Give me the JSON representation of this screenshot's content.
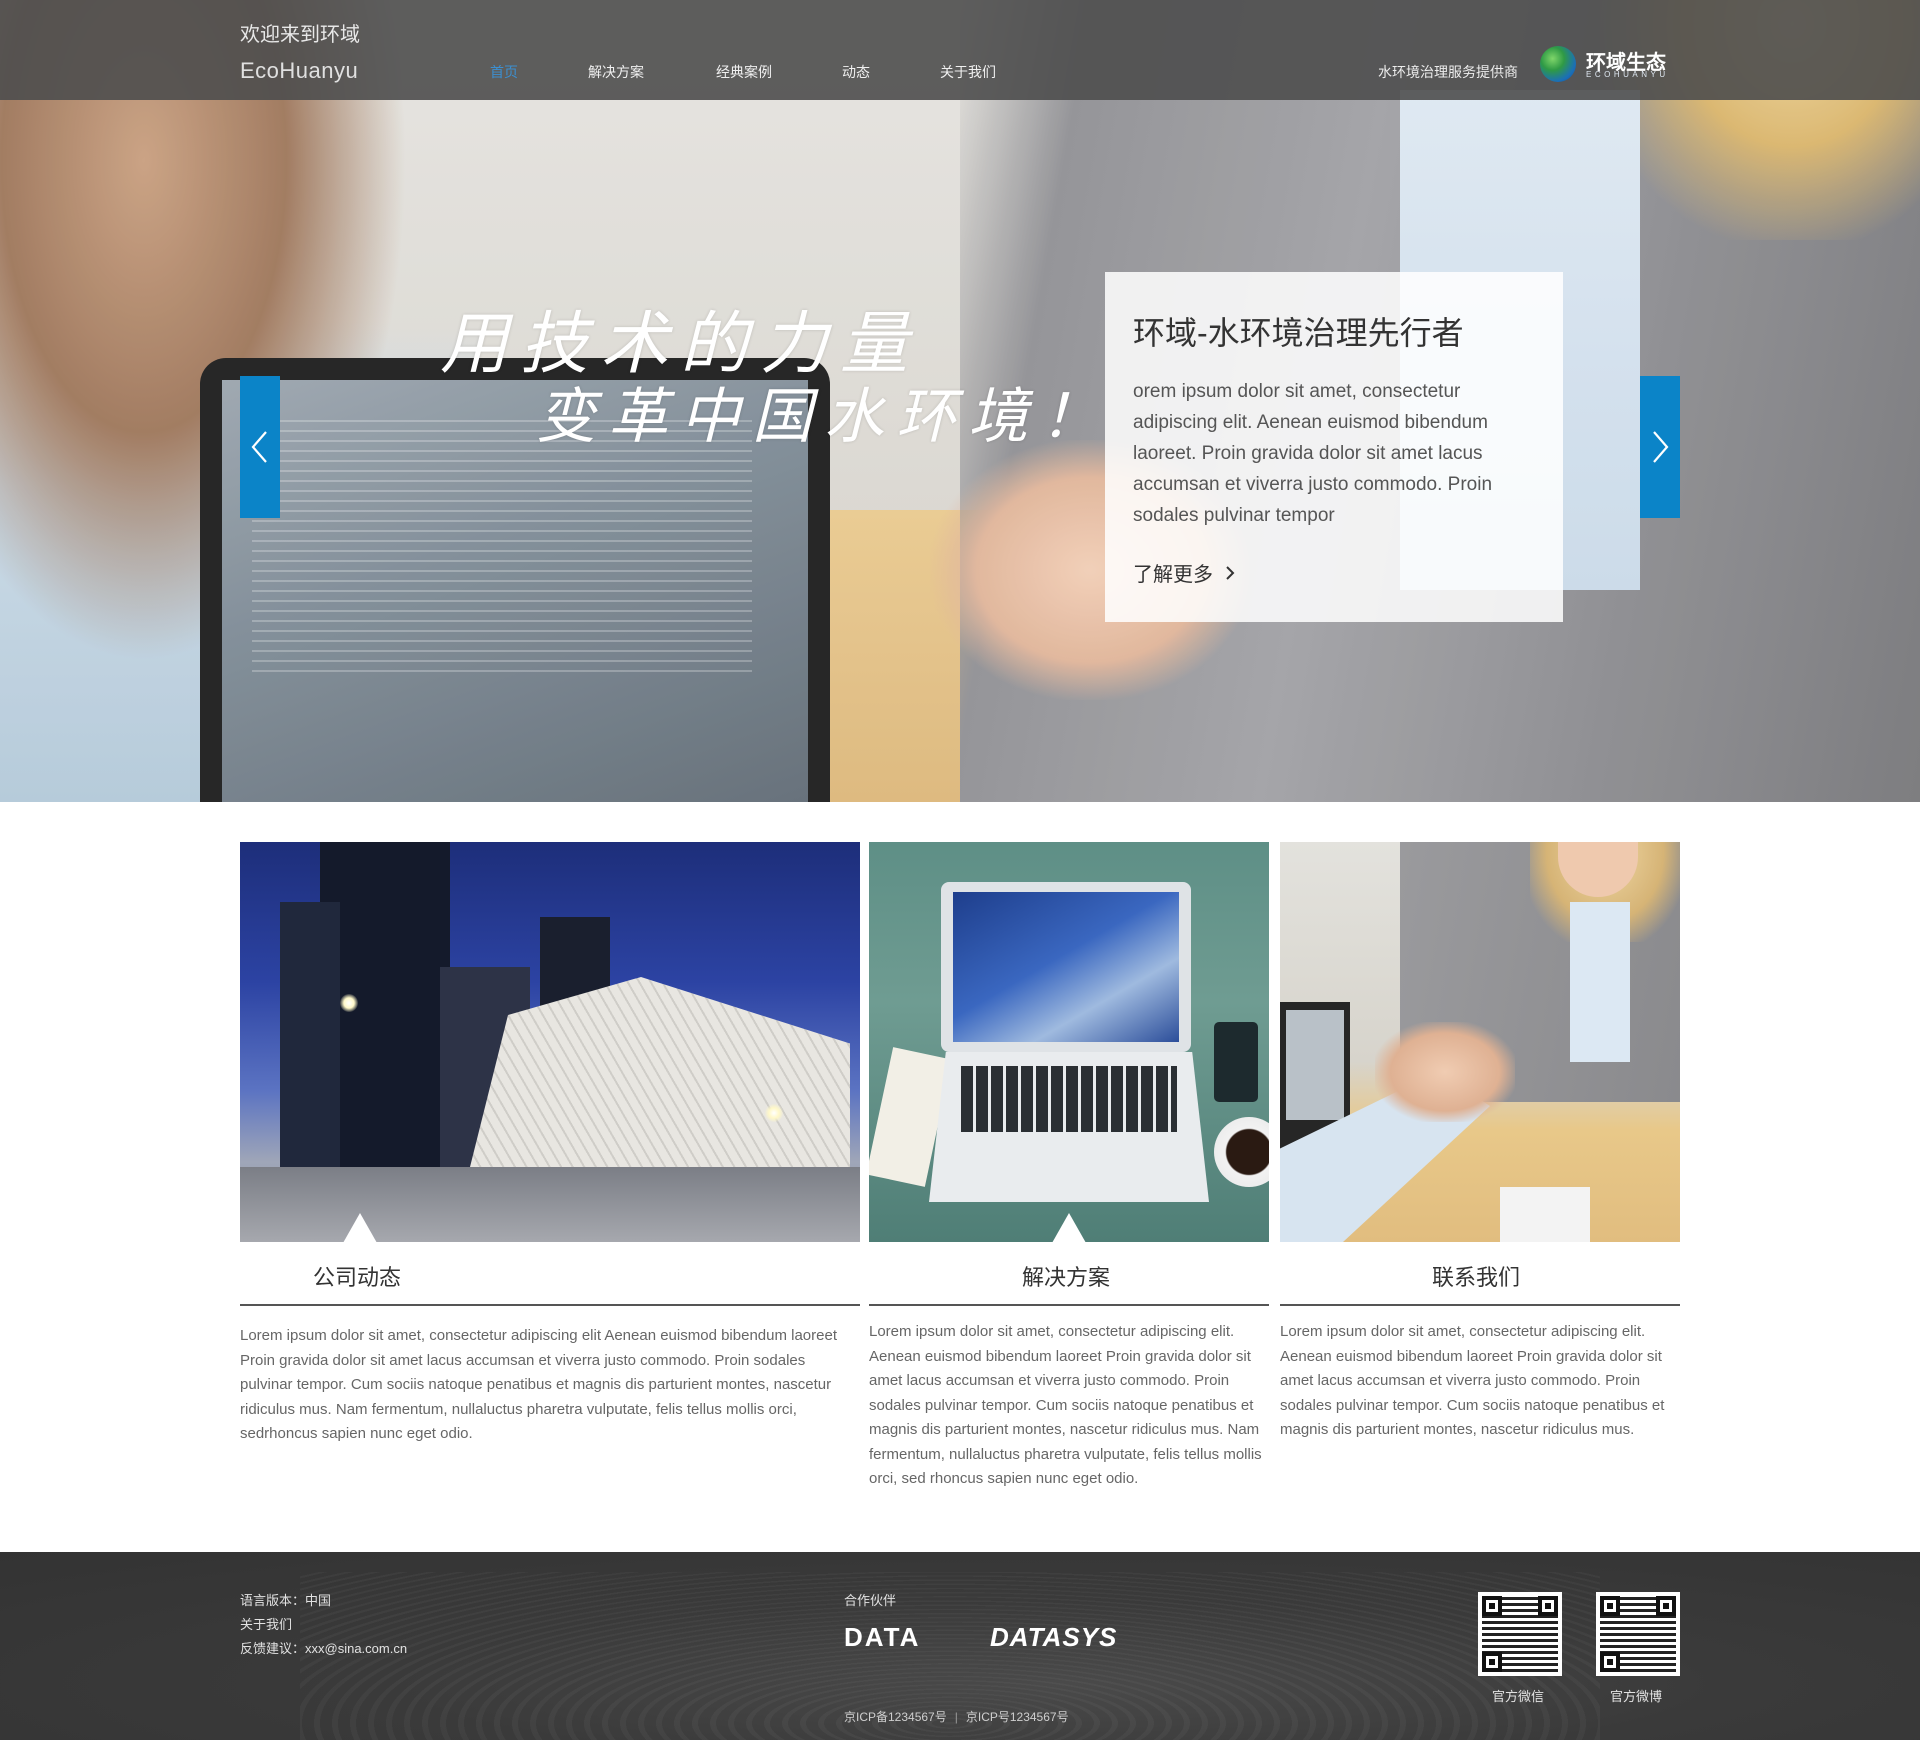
{
  "header": {
    "welcome": "欢迎来到环域",
    "brand_en": "EcoHuanyu",
    "nav": [
      {
        "label": "首页",
        "active": true
      },
      {
        "label": "解决方案",
        "active": false
      },
      {
        "label": "经典案例",
        "active": false
      },
      {
        "label": "动态",
        "active": false
      },
      {
        "label": "关于我们",
        "active": false
      }
    ],
    "tagline": "水环境治理服务提供商",
    "logo": {
      "name": "环域生态",
      "sub": "ECOHUANYU"
    }
  },
  "hero": {
    "slogan_line1": "用技术的力量",
    "slogan_line2": "变革中国水环境！",
    "prev_icon": "chevron-left-icon",
    "next_icon": "chevron-right-icon",
    "caption": {
      "title": "环域-水环境治理先行者",
      "body": "orem ipsum dolor sit amet, consectetur adipiscing elit. Aenean euismod bibendum laoreet. Proin gravida dolor sit amet lacus accumsan et viverra justo commodo. Proin sodales pulvinar tempor",
      "more": "了解更多"
    }
  },
  "features": [
    {
      "title": "公司动态",
      "text": "Lorem ipsum  dolor  sit  amet, consectetur adipiscing elit Aenean euismod bibendum laoreet Proin gravida dolor sit amet lacus accumsan et viverra justo commodo. Proin sodales pulvinar tempor. Cum sociis natoque penatibus et magnis dis parturient montes, nascetur ridiculus mus. Nam fermentum, nullaluctus pharetra vulputate, felis tellus mollis orci, sedrhoncus sapien nunc eget odio."
    },
    {
      "title": "解决方案",
      "text": "Lorem ipsum dolor sit amet, consectetur adipiscing elit. Aenean euismod bibendum laoreet Proin gravida dolor sit amet lacus accumsan et viverra justo commodo. Proin sodales pulvinar tempor. Cum sociis natoque penatibus et magnis dis parturient montes, nascetur ridiculus mus. Nam fermentum, nullaluctus pharetra vulputate, felis tellus mollis orci, sed rhoncus sapien nunc eget odio."
    },
    {
      "title": "联系我们",
      "text": "Lorem ipsum dolor sit amet, consectetur adipiscing elit. Aenean euismod bibendum laoreet Proin gravida dolor sit amet lacus accumsan et viverra justo commodo. Proin sodales pulvinar tempor. Cum sociis natoque penatibus et magnis dis parturient montes, nascetur ridiculus mus."
    }
  ],
  "footer": {
    "language": "语言版本：中国",
    "about": "关于我们",
    "feedback": "反馈建议：xxx@sina.com.cn",
    "partners_label": "合作伙伴",
    "partners": [
      "DATA",
      "DATASYS"
    ],
    "qr_codes": [
      {
        "label": "官方微信",
        "icon": "qr-code-icon"
      },
      {
        "label": "官方微博",
        "icon": "qr-code-icon"
      }
    ],
    "icp_1": "京ICP备1234567号",
    "icp_sep": "|",
    "icp_2": "京ICP号1234567号"
  },
  "colors": {
    "accent_blue": "#0b84c8",
    "nav_active": "#3c8fd0",
    "topbar": "#4e4e4e",
    "footer": "#333333"
  }
}
